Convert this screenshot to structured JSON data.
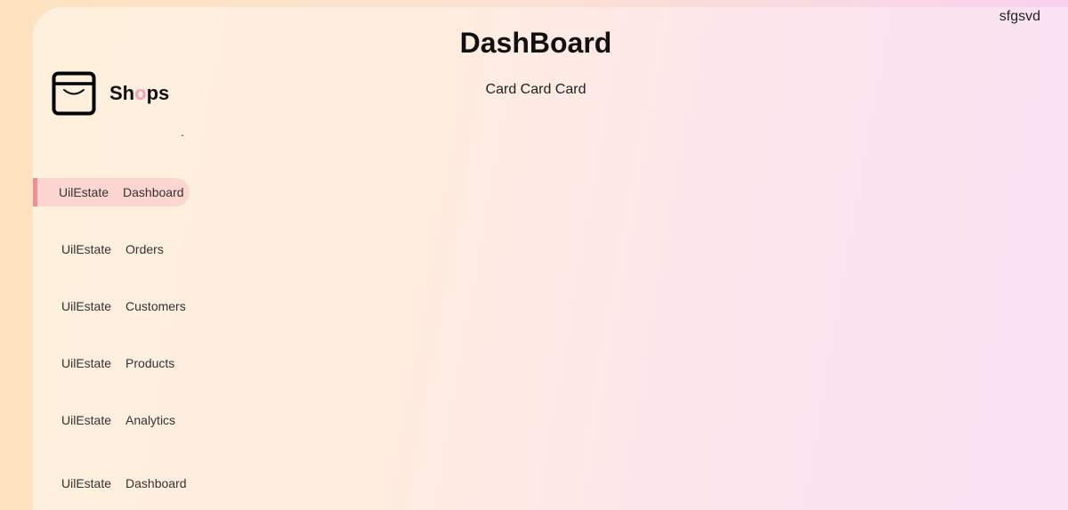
{
  "header": {
    "user": "sfgsvd",
    "title": "DashBoard",
    "cards": "Card Card Card"
  },
  "logo": {
    "text_before": "Sh",
    "text_accent": "o",
    "text_after": "ps",
    "dot": "."
  },
  "sidebar": {
    "items": [
      {
        "icon": "UilEstate",
        "label": "Dashboard",
        "active": true
      },
      {
        "icon": "UilEstate",
        "label": "Orders"
      },
      {
        "icon": "UilEstate",
        "label": "Customers"
      },
      {
        "icon": "UilEstate",
        "label": "Products"
      },
      {
        "icon": "UilEstate",
        "label": "Analytics"
      },
      {
        "icon": "UilEstate",
        "label": "Dashboard"
      }
    ]
  },
  "colors": {
    "accent": "#f4a3b8",
    "active_bg": "#fdd6d2",
    "active_bar": "#f48f96"
  }
}
